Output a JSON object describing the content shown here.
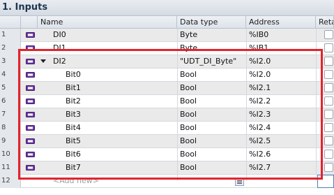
{
  "section_title": "1. Inputs",
  "columns": {
    "name": "Name",
    "data_type": "Data type",
    "address": "Address",
    "retain": "Reta"
  },
  "rows": [
    {
      "num": "1",
      "name": "DI0",
      "type": "Byte",
      "address": "%IB0",
      "indent": 0,
      "expandable": false
    },
    {
      "num": "2",
      "name": "DI1",
      "type": "Byte",
      "address": "%IB1",
      "indent": 0,
      "expandable": false
    },
    {
      "num": "3",
      "name": "DI2",
      "type": "\"UDT_DI_Byte\"",
      "address": "%I2.0",
      "indent": 0,
      "expandable": true
    },
    {
      "num": "4",
      "name": "Bit0",
      "type": "Bool",
      "address": "%I2.0",
      "indent": 1,
      "expandable": false
    },
    {
      "num": "5",
      "name": "Bit1",
      "type": "Bool",
      "address": "%I2.1",
      "indent": 1,
      "expandable": false
    },
    {
      "num": "6",
      "name": "Bit2",
      "type": "Bool",
      "address": "%I2.2",
      "indent": 1,
      "expandable": false
    },
    {
      "num": "7",
      "name": "Bit3",
      "type": "Bool",
      "address": "%I2.3",
      "indent": 1,
      "expandable": false
    },
    {
      "num": "8",
      "name": "Bit4",
      "type": "Bool",
      "address": "%I2.4",
      "indent": 1,
      "expandable": false
    },
    {
      "num": "9",
      "name": "Bit5",
      "type": "Bool",
      "address": "%I2.5",
      "indent": 1,
      "expandable": false
    },
    {
      "num": "10",
      "name": "Bit6",
      "type": "Bool",
      "address": "%I2.6",
      "indent": 1,
      "expandable": false
    },
    {
      "num": "11",
      "name": "Bit7",
      "type": "Bool",
      "address": "%I2.7",
      "indent": 1,
      "expandable": false
    }
  ],
  "add_row": {
    "num": "12",
    "placeholder": "<Add new>"
  },
  "colors": {
    "highlight_box": "#e4232d",
    "tag_icon": "#6f3aa8"
  }
}
